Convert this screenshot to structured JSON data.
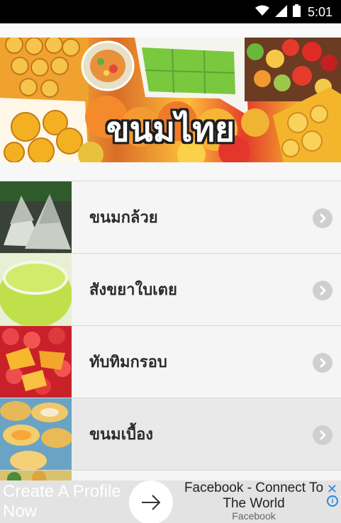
{
  "status_bar": {
    "time": "5:01",
    "icons": [
      "wifi-icon",
      "signal-icon",
      "battery-icon"
    ]
  },
  "banner": {
    "title": "ขนมไทย"
  },
  "menu": {
    "items": [
      {
        "label": "ขนมกล้วย",
        "thumb_colors": [
          "#cfd6d0",
          "#8a8a82",
          "#3b3f38"
        ]
      },
      {
        "label": "สังขยาใบเตย",
        "thumb_colors": [
          "#c6e34a",
          "#a5c82b",
          "#e8efb8"
        ]
      },
      {
        "label": "ทับทิมกรอบ",
        "thumb_colors": [
          "#e63a3a",
          "#f4b52e",
          "#bf1f26"
        ]
      },
      {
        "label": "ขนมเบื้อง",
        "thumb_colors": [
          "#f1c85e",
          "#c8893a",
          "#6aa6c8"
        ],
        "pressed": true
      }
    ],
    "chevron_icon": "chevron-right-icon"
  },
  "ad": {
    "left_text": "Create A Profile Now",
    "headline": "Facebook - Connect To The World",
    "source": "Facebook",
    "arrow_icon": "arrow-right-icon",
    "close_icon": "close-icon",
    "info_icon": "info-icon",
    "accent": "#2b88d8"
  }
}
